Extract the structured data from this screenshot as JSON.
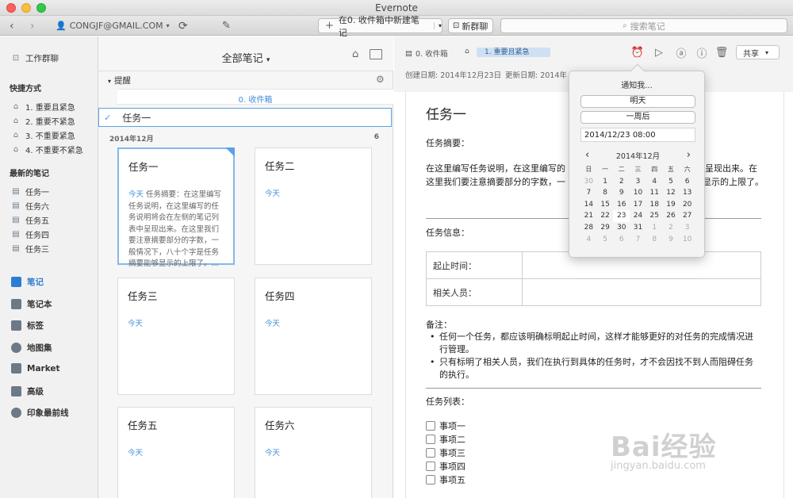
{
  "window": {
    "title": "Evernote"
  },
  "toolbar": {
    "account": "CONGJF@GMAIL.COM",
    "new_note": "在0. 收件箱中新建笔记",
    "new_chat": "新群聊",
    "search_placeholder": "搜索笔记"
  },
  "sidebar": {
    "work_chat": "工作群聊",
    "shortcuts_header": "快捷方式",
    "shortcuts": [
      "1. 重要且紧急",
      "2. 重要不紧急",
      "3. 不重要紧急",
      "4. 不重要不紧急"
    ],
    "recent_header": "最新的笔记",
    "recent": [
      "任务一",
      "任务六",
      "任务五",
      "任务四",
      "任务三"
    ],
    "main_items": [
      "笔记",
      "笔记本",
      "标签",
      "地图集",
      "Market",
      "高级",
      "印象最前线"
    ]
  },
  "notelist": {
    "title": "全部笔记",
    "reminders_label": "提醒",
    "inbox_notebook": "0. 收件箱",
    "reminder_task": "任务一",
    "month": "2014年12月",
    "count": "6",
    "today_label": "今天",
    "cards": [
      {
        "title": "任务一",
        "date": "今天",
        "snippet": "任务摘要：在这里编写任务说明，在这里编写的任务说明将会在左侧的笔记列表中呈现出来。在这里我们要注意摘要部分的字数，一般情况下，八十个字是任务摘要能够显示的上限了。..."
      },
      {
        "title": "任务二",
        "date": "今天",
        "snippet": ""
      },
      {
        "title": "任务三",
        "date": "今天",
        "snippet": ""
      },
      {
        "title": "任务四",
        "date": "今天",
        "snippet": ""
      },
      {
        "title": "任务五",
        "date": "今天",
        "snippet": ""
      },
      {
        "title": "任务六",
        "date": "今天",
        "snippet": ""
      }
    ]
  },
  "editor": {
    "notebook": "0. 收件箱",
    "tag": "1. 重要且紧急",
    "share": "共享",
    "created": "创建日期: 2014年12月23日",
    "updated": "更新日期: 2014年12月23日",
    "title": "任务一",
    "summary_label": "任务摘要：",
    "summary_line1": "在这里编写任务说明，在这里编写的",
    "summary_line1_end": "呈现出来。在",
    "summary_line2": "这里我们要注意摘要部分的字数，一",
    "summary_line2_end": "够显示的上限了。",
    "info_label": "任务信息：",
    "table": [
      [
        "起止时间：",
        ""
      ],
      [
        "相关人员：",
        ""
      ]
    ],
    "notes_label": "备注：",
    "bullets": [
      "任何一个任务，都应该明确标明起止时间，这样才能够更好的对任务的完成情况进行管理。",
      "只有标明了相关人员，我们在执行到具体的任务时，才不会因找不到人而阻碍任务的执行。"
    ],
    "list_label": "任务列表：",
    "checklist": [
      "事项一",
      "事项二",
      "事项三",
      "事项四",
      "事项五"
    ]
  },
  "reminder_popover": {
    "title": "通知我...",
    "tomorrow": "明天",
    "next_week": "一周后",
    "datetime": "2014/12/23 08:00",
    "month": "2014年12月",
    "weekdays": [
      "日",
      "一",
      "二",
      "三",
      "四",
      "五",
      "六"
    ],
    "weeks": [
      [
        "30",
        "1",
        "2",
        "3",
        "4",
        "5",
        "6"
      ],
      [
        "7",
        "8",
        "9",
        "10",
        "11",
        "12",
        "13"
      ],
      [
        "14",
        "15",
        "16",
        "17",
        "18",
        "19",
        "20"
      ],
      [
        "21",
        "22",
        "23",
        "24",
        "25",
        "26",
        "27"
      ],
      [
        "28",
        "29",
        "30",
        "31",
        "1",
        "2",
        "3"
      ],
      [
        "4",
        "5",
        "6",
        "7",
        "8",
        "9",
        "10"
      ]
    ]
  },
  "watermark": {
    "brand": "Bai经验",
    "url": "jingyan.baidu.com"
  }
}
